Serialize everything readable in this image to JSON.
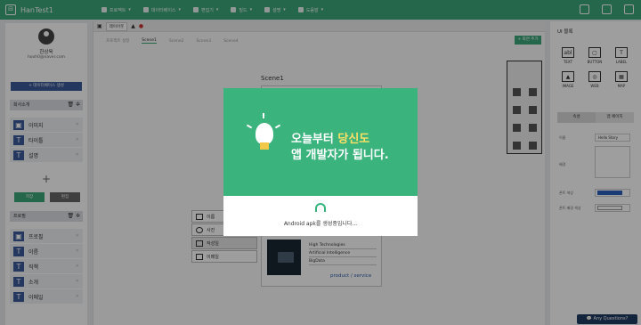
{
  "app": {
    "title": "HanTest1"
  },
  "menu": [
    {
      "label": "프로젝트"
    },
    {
      "label": "데이터베이스"
    },
    {
      "label": "편집기"
    },
    {
      "label": "빌드"
    },
    {
      "label": "설명"
    },
    {
      "label": "도움말"
    }
  ],
  "user": {
    "name": "한상욱",
    "email": "hooh0@naver.com"
  },
  "left": {
    "db_button": "+ 데이터베이스 생성",
    "section1": {
      "title": "회사소개",
      "items": [
        {
          "icon": "image-icon",
          "label": "이미지"
        },
        {
          "icon": "text-icon",
          "label": "타이틀"
        },
        {
          "icon": "text-icon",
          "label": "설명"
        }
      ],
      "save": "저장",
      "edit": "편집"
    },
    "section2": {
      "title": "프로필",
      "items": [
        {
          "icon": "image-icon",
          "label": "프로필"
        },
        {
          "icon": "text-icon",
          "label": "이름"
        },
        {
          "icon": "text-icon",
          "label": "직책"
        },
        {
          "icon": "text-icon",
          "label": "소개"
        },
        {
          "icon": "text-icon",
          "label": "이메일"
        }
      ]
    }
  },
  "canvas": {
    "tab": "레이아웃",
    "scenes": [
      "프로젝트 설정",
      "Scene1",
      "Scene2",
      "Scene3",
      "Scene4"
    ],
    "add_scene": "+ 화면 추가",
    "scene_label": "Scene1",
    "profile_rows": [
      "이름",
      "사진",
      "작성일",
      "이메일"
    ],
    "biz_title": "Business",
    "biz_items": [
      "High Technologies",
      "Artificial Intelligence",
      "BigData"
    ],
    "biz_link": "product / service"
  },
  "right": {
    "title": "UI 블록",
    "components": [
      "TEXT",
      "BUTTON",
      "LABEL",
      "IMAGE",
      "WEB",
      "MAP"
    ],
    "tabs": [
      "속성",
      "앱 페이지"
    ],
    "props": [
      {
        "label": "이름",
        "value": "Hello Story"
      },
      {
        "label": "배경",
        "value": ""
      },
      {
        "label": "폰트 색상",
        "value": ""
      },
      {
        "label": "폰트 배경 색상",
        "value": ""
      }
    ],
    "colors": {
      "font": "#2d5fbf",
      "bg": "#ffffff"
    }
  },
  "modal": {
    "line1": "오늘부터 ",
    "line1_highlight": "당신도",
    "line2": "앱 개발자가 됩니다.",
    "message": "Android apk를 생성중입니다..."
  },
  "chat": {
    "label": "Any Questions?"
  }
}
